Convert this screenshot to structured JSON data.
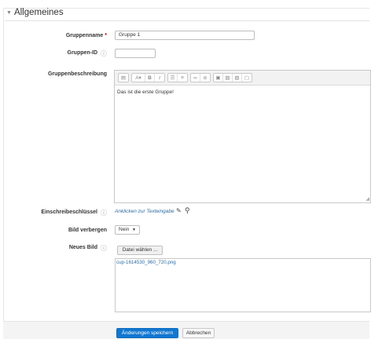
{
  "section": {
    "title": "Allgemeines",
    "collapse_icon": "chevron-down-icon"
  },
  "fields": {
    "group_name": {
      "label": "Gruppenname",
      "required_mark": "*",
      "value": "Gruppe 1"
    },
    "group_id": {
      "label": "Gruppen-ID",
      "help_icon": "help-icon",
      "value": ""
    },
    "description": {
      "label": "Gruppenbeschreibung",
      "content": "Das ist die erste Gruppe!",
      "toolbar_icons": [
        "paragraph-icon",
        "text-style-icon",
        "bold-icon",
        "italic-icon",
        "unordered-list-icon",
        "ordered-list-icon",
        "link-icon",
        "unlink-icon",
        "media-icon",
        "image-icon",
        "file-icon",
        "manage-files-icon"
      ],
      "toolbar_glyphs": {
        "bold": "B",
        "italic": "I"
      }
    },
    "enrolment_key": {
      "label": "Einschreibeschlüssel",
      "link_text": "Anklicken zur Texteingabe",
      "edit_icon": "pencil-icon",
      "reveal_icon": "magnifier-icon"
    },
    "hide_picture": {
      "label": "Bild verbergen",
      "value": "Nein"
    },
    "new_picture": {
      "label": "Neues Bild",
      "choose_button": "Datei wählen ...",
      "file_name": "cup-1614530_960_720.png"
    }
  },
  "actions": {
    "save": "Änderungen speichern",
    "cancel": "Abbrechen"
  },
  "colors": {
    "link": "#2d6ca2",
    "primary_button": "#1177d1",
    "required": "#cc0000"
  }
}
